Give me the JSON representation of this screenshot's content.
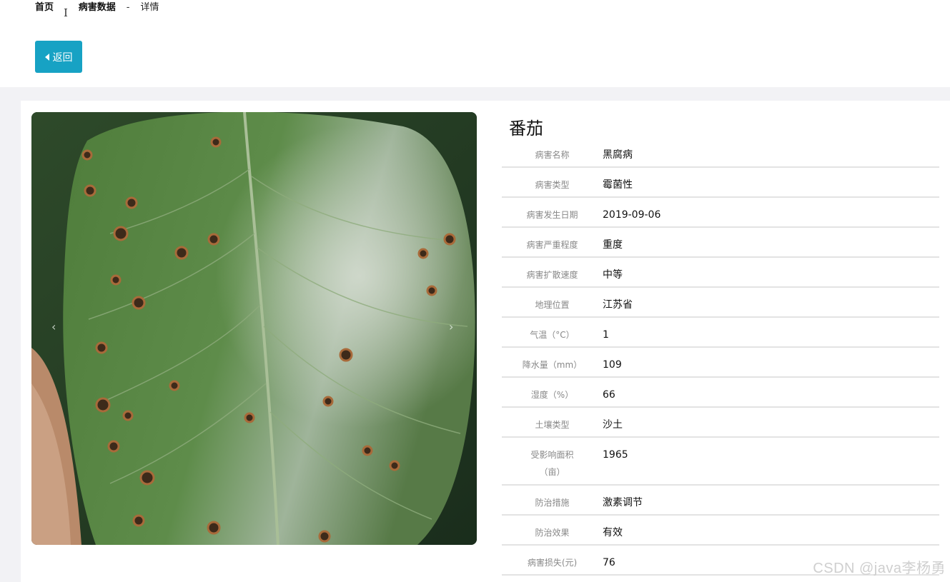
{
  "breadcrumb": {
    "home": "首页",
    "section": "病害数据",
    "separator": "-",
    "current": "详情"
  },
  "back_button": {
    "label": "返回"
  },
  "carousel": {
    "prev": "‹",
    "next": "›"
  },
  "detail": {
    "title": "番茄",
    "rows": [
      {
        "label": "病害名称",
        "value": "黑腐病"
      },
      {
        "label": "病害类型",
        "value": "霉菌性"
      },
      {
        "label": "病害发生日期",
        "value": "2019-09-06"
      },
      {
        "label": "病害严重程度",
        "value": "重度"
      },
      {
        "label": "病害扩散速度",
        "value": "中等"
      },
      {
        "label": "地理位置",
        "value": "江苏省"
      },
      {
        "label": "气温（°C）",
        "value": "1"
      },
      {
        "label": "降水量（mm）",
        "value": "109"
      },
      {
        "label": "湿度（%）",
        "value": "66"
      },
      {
        "label": "土壤类型",
        "value": "沙土"
      },
      {
        "label": "受影响面积（亩）",
        "value": "1965"
      },
      {
        "label": "防治措施",
        "value": "激素调节"
      },
      {
        "label": "防治效果",
        "value": "有效"
      },
      {
        "label": "病害损失(元)",
        "value": "76"
      }
    ]
  },
  "watermark": "CSDN @java李杨勇",
  "colors": {
    "accent": "#17a2c4",
    "page_bg": "#f2f2f5",
    "divider": "#e3e3e3"
  }
}
